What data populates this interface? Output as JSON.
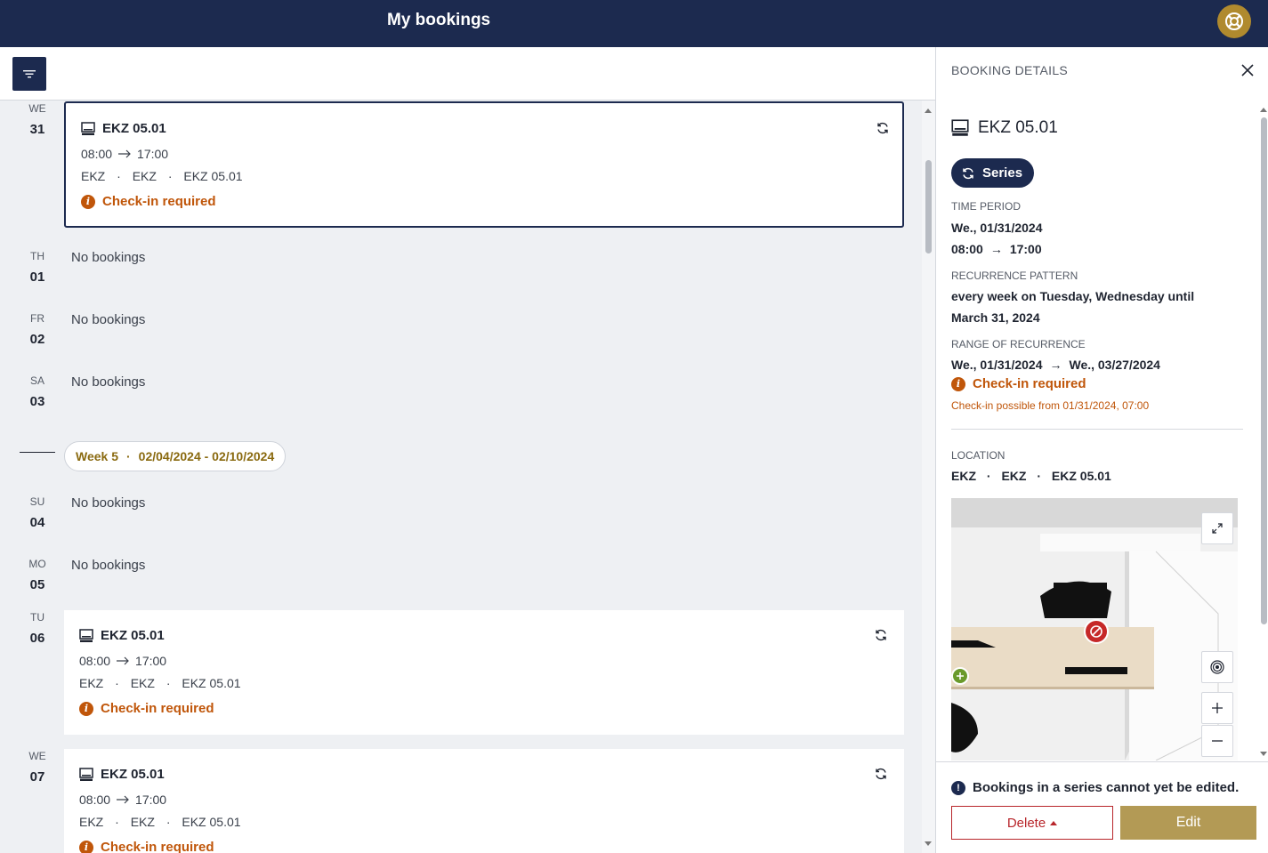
{
  "header": {
    "title": "My bookings"
  },
  "days": [
    {
      "dow": "WE",
      "num": "31"
    },
    {
      "dow": "TH",
      "num": "01"
    },
    {
      "dow": "FR",
      "num": "02"
    },
    {
      "dow": "SA",
      "num": "03"
    },
    {
      "dow": "SU",
      "num": "04"
    },
    {
      "dow": "MO",
      "num": "05"
    },
    {
      "dow": "TU",
      "num": "06"
    },
    {
      "dow": "WE",
      "num": "07"
    }
  ],
  "no_bookings": "No bookings",
  "week": {
    "label": "Week 5",
    "sep": "·",
    "range": "02/04/2024 - 02/10/2024"
  },
  "booking": {
    "name": "EKZ 05.01",
    "start": "08:00",
    "end": "17:00",
    "loc1": "EKZ",
    "loc2": "EKZ",
    "loc3": "EKZ 05.01",
    "sep": "·",
    "checkin": "Check-in required"
  },
  "details": {
    "header": "BOOKING DETAILS",
    "title": "EKZ 05.01",
    "series": "Series",
    "time_period_label": "TIME PERIOD",
    "date": "We., 01/31/2024",
    "start": "08:00",
    "end": "17:00",
    "recurrence_label": "RECURRENCE PATTERN",
    "recurrence_line1": "every week on Tuesday, Wednesday until",
    "recurrence_line2": "March 31, 2024",
    "range_label": "RANGE OF RECURRENCE",
    "range_start": "We., 01/31/2024",
    "range_end": "We., 03/27/2024",
    "checkin": "Check-in required",
    "checkin_possible": "Check-in possible from 01/31/2024, 07:00",
    "location_label": "LOCATION",
    "loc1": "EKZ",
    "loc2": "EKZ",
    "loc3": "EKZ 05.01",
    "sep": "·"
  },
  "footer": {
    "note": "Bookings in a series cannot yet be edited.",
    "delete": "Delete",
    "edit": "Edit"
  },
  "colors": {
    "navy": "#1c2a4f",
    "warning": "#c0560a",
    "gold": "#b39a55",
    "danger": "#b8262b"
  }
}
